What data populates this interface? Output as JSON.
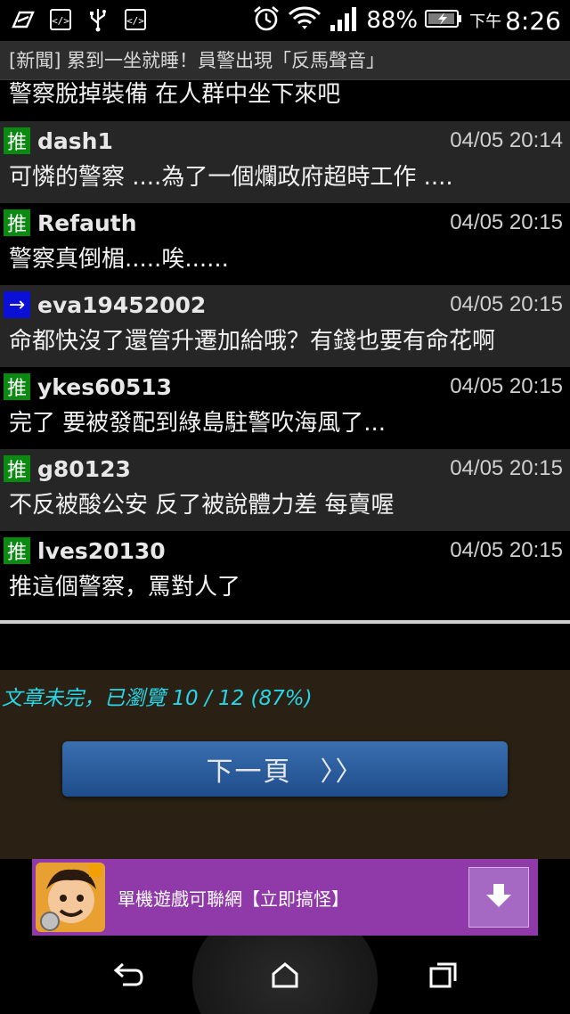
{
  "status_bar": {
    "battery": "88%",
    "ampm": "下午",
    "time": "8:26",
    "icons": [
      "flash-icon",
      "code-icon",
      "usb-icon",
      "code-icon",
      "alarm-icon",
      "wifi-icon",
      "signal-icon",
      "battery-icon"
    ]
  },
  "title": "[新聞] 累到一坐就睡！員警出現「反馬聲音」",
  "top_line": "警察脫掉裝備 在人群中坐下來吧",
  "comments": [
    {
      "tag": "推",
      "tag_type": "push",
      "user": "dash1",
      "time": "04/05 20:14",
      "text": "可憐的警察 ....為了一個爛政府超時工作 ...."
    },
    {
      "tag": "推",
      "tag_type": "push",
      "user": "Refauth",
      "time": "04/05 20:15",
      "text": "警察真倒楣.....唉......"
    },
    {
      "tag": "→",
      "tag_type": "arrow",
      "user": "eva19452002",
      "time": "04/05 20:15",
      "text": "命都快沒了還管升遷加給哦？有錢也要有命花啊"
    },
    {
      "tag": "推",
      "tag_type": "push",
      "user": "ykes60513",
      "time": "04/05 20:15",
      "text": "完了 要被發配到綠島駐警吹海風了..."
    },
    {
      "tag": "推",
      "tag_type": "push",
      "user": "g80123",
      "time": "04/05 20:15",
      "text": "不反被酸公安 反了被說體力差 每賣喔"
    },
    {
      "tag": "推",
      "tag_type": "push",
      "user": "lves20130",
      "time": "04/05 20:15",
      "text": "推這個警察，罵對人了"
    }
  ],
  "progress": {
    "text": "文章未完，已瀏覽 10 / 12 (87%)",
    "current": 10,
    "total": 12
  },
  "next_button": "下一頁　〉〉",
  "ad": {
    "text": "單機遊戲可聯網【立即搞怪】",
    "download_icon": "download-icon"
  },
  "nav": [
    "back-icon",
    "home-icon",
    "recent-apps-icon"
  ],
  "colors": {
    "push_tag": "#0a8a10",
    "arrow_tag": "#0a10d6",
    "progress_text": "#27d6e8",
    "button": "#2b5d9e",
    "ad_bg": "#8f3aa8"
  }
}
